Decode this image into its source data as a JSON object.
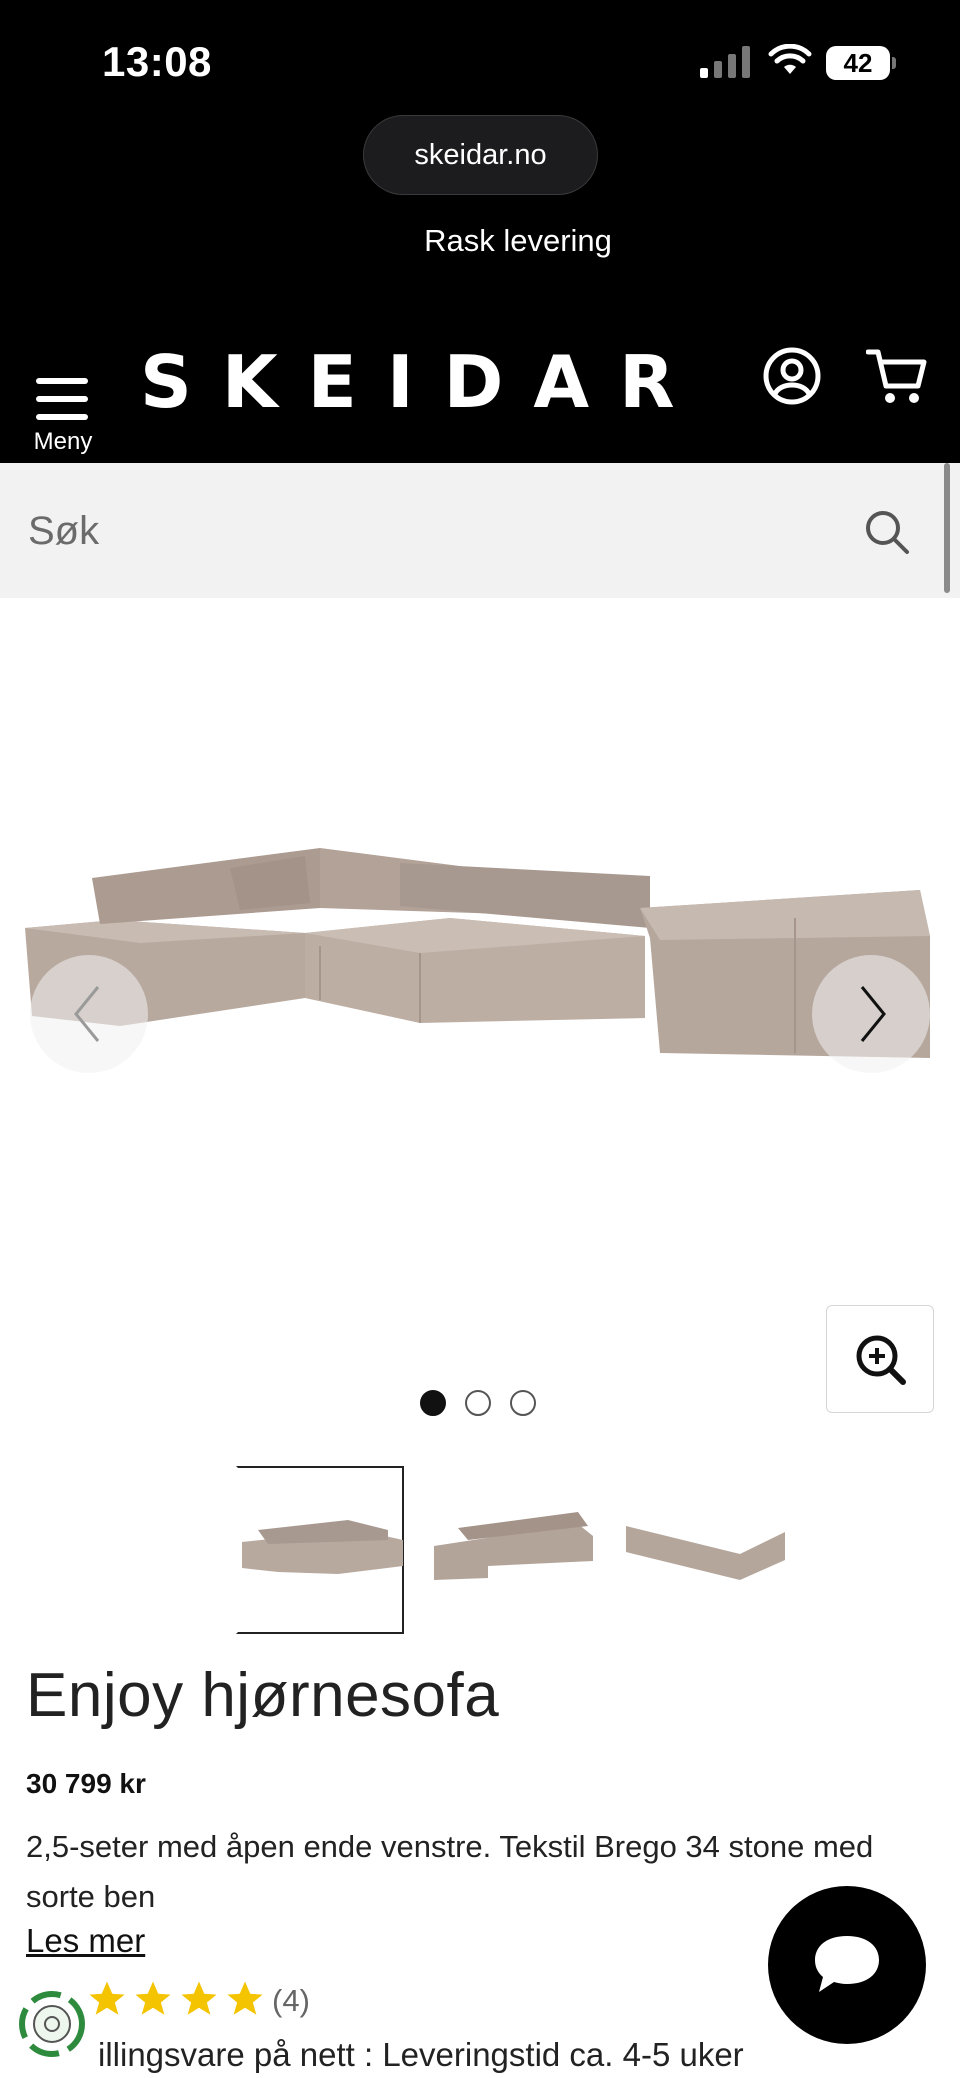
{
  "status_bar": {
    "time": "13:08",
    "battery": "42",
    "battery_level": 0.42
  },
  "browser": {
    "url": "skeidar.no"
  },
  "promo": {
    "text": "Rask levering"
  },
  "header": {
    "menu_label": "Meny",
    "logo": "SKEIDAR",
    "icons": [
      "menu-icon",
      "account-icon",
      "cart-icon"
    ]
  },
  "search": {
    "placeholder": "Søk",
    "value": ""
  },
  "gallery": {
    "image_count": 3,
    "active_index": 0,
    "icons": [
      "chevron-left-icon",
      "chevron-right-icon",
      "zoom-in-icon"
    ]
  },
  "product": {
    "title": "Enjoy hjørnesofa",
    "price": "30 799 kr",
    "description": "2,5-seter med åpen ende venstre. Tekstil Brego 34 stone med sorte ben",
    "read_more": "Les mer",
    "rating_stars": 4,
    "review_count": "(4)",
    "delivery": "illingsvare på nett : Leveringstid ca. 4-5 uker"
  },
  "colors": {
    "header_bg": "#000000",
    "search_bg": "#f2f2f2",
    "star": "#f5c400",
    "sofa": "#b9aaa0"
  }
}
